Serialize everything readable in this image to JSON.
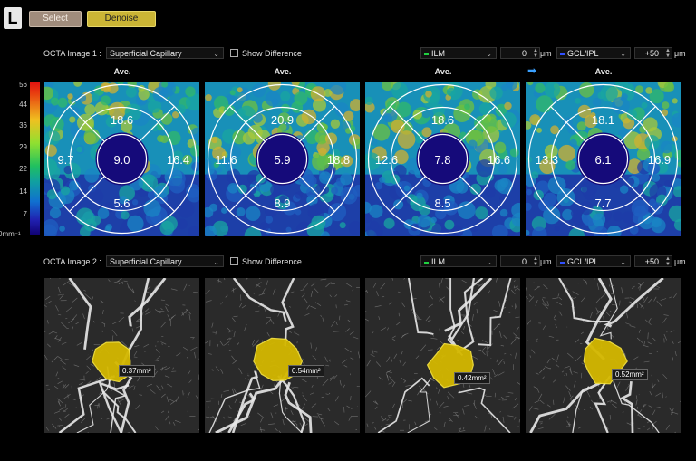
{
  "header": {
    "eye": "L",
    "select_label": "Select",
    "denoise_label": "Denoise"
  },
  "row1": {
    "label": "OCTA Image 1 :",
    "slab": "Superficial Capillary",
    "show_diff": "Show Difference",
    "upper_layer": "ILM",
    "upper_offset": "0",
    "lower_layer": "GCL/IPL",
    "lower_offset": "+50",
    "unit": "μm"
  },
  "row2": {
    "label": "OCTA Image 2 :",
    "slab": "Superficial Capillary",
    "show_diff": "Show Difference",
    "upper_layer": "ILM",
    "upper_offset": "0",
    "lower_layer": "GCL/IPL",
    "lower_offset": "+50",
    "unit": "μm"
  },
  "ave_label": "Ave.",
  "colorbar": {
    "ticks": [
      "56",
      "44",
      "36",
      "29",
      "22",
      "14",
      "7",
      "0mm⁻¹"
    ]
  },
  "density_panels": [
    {
      "top": "18.6",
      "left": "9.7",
      "center": "9.0",
      "right": "16.4",
      "bottom": "5.6"
    },
    {
      "top": "20.9",
      "left": "11.6",
      "center": "5.9",
      "right": "18.8",
      "bottom": "8.9"
    },
    {
      "top": "18.6",
      "left": "12.6",
      "center": "7.8",
      "right": "16.6",
      "bottom": "8.5"
    },
    {
      "top": "18.1",
      "left": "13.3",
      "center": "6.1",
      "right": "16.9",
      "bottom": "7.7"
    }
  ],
  "faz_panels": [
    {
      "area": "0.37mm²"
    },
    {
      "area": "0.54mm²"
    },
    {
      "area": "0.42mm²"
    },
    {
      "area": "0.52mm²"
    }
  ],
  "colors": {
    "accent_yellow": "#cbb535",
    "select_btn": "#a08c7c",
    "arrow_blue": "#3aa0ff",
    "ilm_green": "#20d040",
    "gcl_blue": "#3050ff",
    "faz_fill": "#d4b800"
  }
}
